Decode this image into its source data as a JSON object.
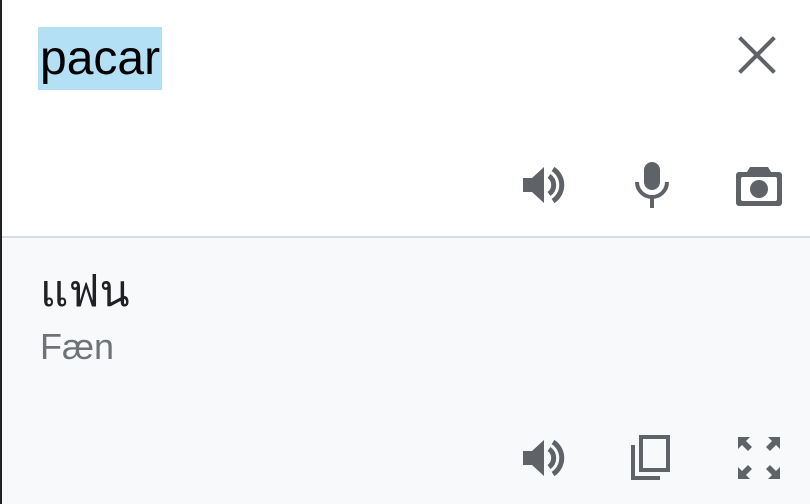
{
  "source": {
    "text": "pacar",
    "highlight_color": "#b3e0f5"
  },
  "result": {
    "translation": "แฟน",
    "romanization": "Fæn"
  },
  "icons": {
    "clear": "close-icon",
    "source_speak": "speaker-icon",
    "microphone": "microphone-icon",
    "camera": "camera-icon",
    "result_speak": "speaker-icon",
    "copy": "copy-icon",
    "fullscreen": "fullscreen-icon"
  },
  "colors": {
    "icon": "#5f6368",
    "result_background": "#f8f9fa",
    "divider": "#dadce0"
  }
}
